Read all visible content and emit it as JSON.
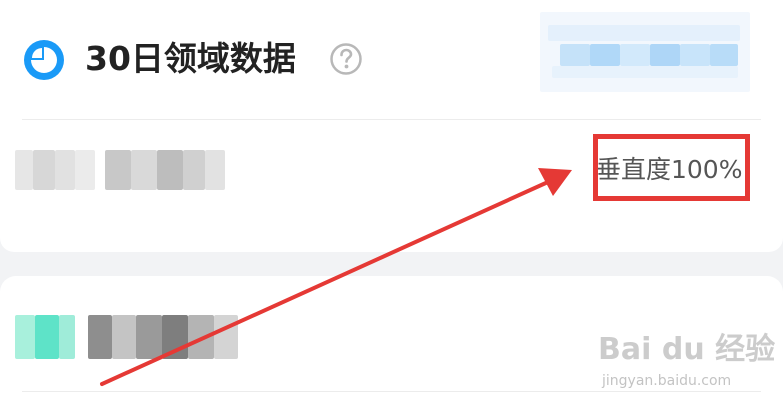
{
  "header": {
    "title": "30日领域数据"
  },
  "stat": {
    "text": "垂直度100%"
  },
  "watermark": {
    "logo": "Bai du 经验",
    "url": "jingyan.baidu.com"
  },
  "colors": {
    "accent": "#1a9af7",
    "annotation": "#e53935",
    "blurred_teal": "#5ee3c8"
  }
}
